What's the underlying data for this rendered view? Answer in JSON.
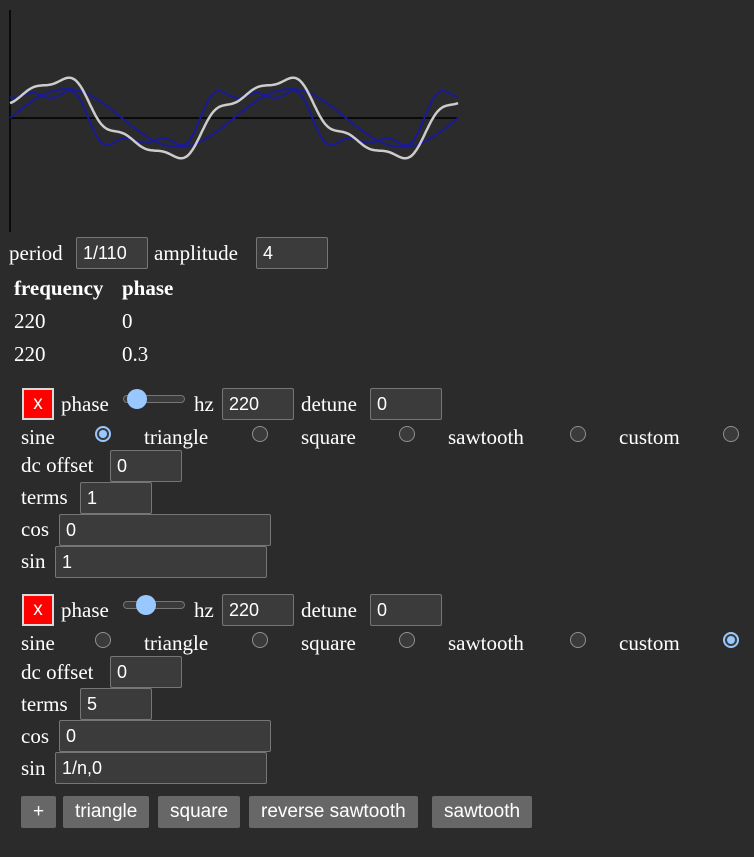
{
  "plot": {
    "colors": {
      "axis": "#000000",
      "sum": "#cccccc",
      "component": "#1a1a99"
    },
    "components": [
      {
        "frequency": 220,
        "phase": 0
      },
      {
        "frequency": 220,
        "phase": 0.3
      }
    ],
    "sum_amplitude": 1
  },
  "controls": {
    "period_label": "period",
    "period_value": "1/110",
    "amplitude_label": "amplitude",
    "amplitude_value": "4"
  },
  "table": {
    "headers": [
      "frequency",
      "phase"
    ],
    "rows": [
      [
        "220",
        "0"
      ],
      [
        "220",
        "0.3"
      ]
    ]
  },
  "oscillators": [
    {
      "remove_label": "x",
      "phase_label": "phase",
      "phase_level": 0.1,
      "hz_label": "hz",
      "hz_value": "220",
      "detune_label": "detune",
      "detune_value": "0",
      "wave_types": [
        "sine",
        "triangle",
        "square",
        "sawtooth",
        "custom"
      ],
      "selected_wave": "sine",
      "dc_offset_label": "dc offset",
      "dc_offset_value": "0",
      "terms_label": "terms",
      "terms_value": "1",
      "cos_label": "cos",
      "cos_value": "0",
      "sin_label": "sin",
      "sin_value": "1"
    },
    {
      "remove_label": "x",
      "phase_label": "phase",
      "phase_level": 0.3,
      "hz_label": "hz",
      "hz_value": "220",
      "detune_label": "detune",
      "detune_value": "0",
      "wave_types": [
        "sine",
        "triangle",
        "square",
        "sawtooth",
        "custom"
      ],
      "selected_wave": "custom",
      "dc_offset_label": "dc offset",
      "dc_offset_value": "0",
      "terms_label": "terms",
      "terms_value": "5",
      "cos_label": "cos",
      "cos_value": "0",
      "sin_label": "sin",
      "sin_value": "1/n,0"
    }
  ],
  "buttons": {
    "add": "+",
    "triangle": "triangle",
    "square": "square",
    "reverse_sawtooth": "reverse sawtooth",
    "sawtooth": "sawtooth"
  }
}
